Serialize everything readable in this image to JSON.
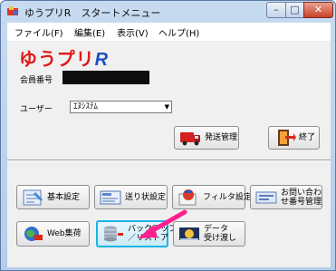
{
  "window": {
    "title": "ゆうプリR　スタートメニュー"
  },
  "menu": [
    "ファイル(F)",
    "編集(E)",
    "表示(V)",
    "ヘルプ(H)"
  ],
  "logo": {
    "main": "ゆうプリ",
    "accent": "R"
  },
  "member_label": "会員番号",
  "user": {
    "label": "ユーザー",
    "value": "ｴﾇｼｽﾃﾑ"
  },
  "buttons": {
    "shipping": "発送管理",
    "exit": "終了",
    "basic": "基本設定",
    "invoice": "送り状設定",
    "filter": "フィルタ設定",
    "inquiry": "お問い合わ\nせ番号管理",
    "web": "Web集荷",
    "backup": "バックアップ\n／リストア",
    "data": "データ\n受け渡し"
  },
  "colors": {
    "logo_red": "#e01818",
    "logo_blue": "#1d4fc4",
    "highlight": "#18b3e6",
    "arrow": "#ff1f8f"
  }
}
